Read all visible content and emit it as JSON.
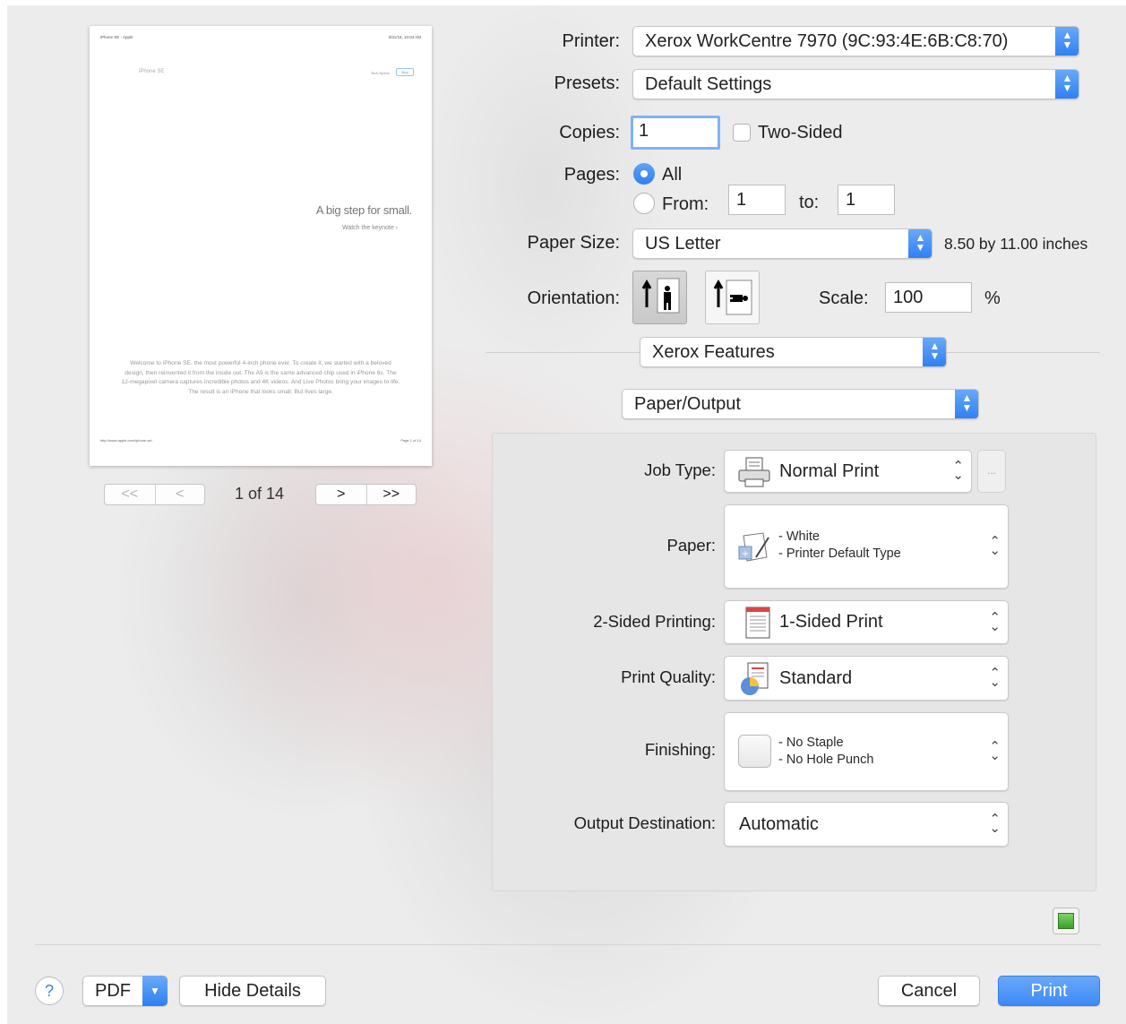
{
  "preview": {
    "header_left": "iPhone SE - Apple",
    "header_right": "3/31/16, 10:04 AM",
    "nav_left": "iPhone SE",
    "nav_right_link": "Tech Specs",
    "nav_right_btn": "Buy",
    "headline": "A big step for small.",
    "subline": "Watch the keynote ›",
    "paragraph": "Welcome to iPhone SE, the most powerful 4-inch phone ever. To create it, we started with a beloved design, then reinvented it from the inside out. The A9 is the same advanced chip used in iPhone 6s. The 12-megapixel camera captures incredible photos and 4K videos. And Live Photos bring your images to life. The result is an iPhone that looks small. But lives large.",
    "footer_left": "http://www.apple.com/iphone-se/",
    "footer_right": "Page 1 of 14",
    "page_indicator": "1 of 14",
    "first_label": "<<",
    "prev_label": "<",
    "next_label": ">",
    "last_label": ">>"
  },
  "printer": {
    "label": "Printer:",
    "value": "Xerox WorkCentre 7970 (9C:93:4E:6B:C8:70)"
  },
  "presets": {
    "label": "Presets:",
    "value": "Default Settings"
  },
  "copies": {
    "label": "Copies:",
    "value": "1",
    "two_sided_label": "Two-Sided"
  },
  "pages": {
    "label": "Pages:",
    "all_label": "All",
    "from_label": "From:",
    "from_value": "1",
    "to_label": "to:",
    "to_value": "1"
  },
  "paper_size": {
    "label": "Paper Size:",
    "value": "US Letter",
    "dimensions": "8.50 by 11.00 inches"
  },
  "orientation": {
    "label": "Orientation:"
  },
  "scale": {
    "label": "Scale:",
    "value": "100",
    "unit": "%"
  },
  "feature_popup": "Xerox Features",
  "section_popup": "Paper/Output",
  "xerox": {
    "job_type": {
      "label": "Job Type:",
      "value": "Normal Print",
      "more": "..."
    },
    "paper": {
      "label": "Paper:",
      "line1": "- White",
      "line2": "- Printer Default Type"
    },
    "two_sided": {
      "label": "2-Sided Printing:",
      "value": "1-Sided Print"
    },
    "quality": {
      "label": "Print Quality:",
      "value": "Standard"
    },
    "finishing": {
      "label": "Finishing:",
      "line1": "- No Staple",
      "line2": "- No Hole Punch"
    },
    "output": {
      "label": "Output Destination:",
      "value": "Automatic"
    }
  },
  "footer": {
    "help_label": "?",
    "pdf_label": "PDF",
    "hide_details_label": "Hide Details",
    "cancel_label": "Cancel",
    "print_label": "Print"
  },
  "colors": {
    "accent": "#2f7ff2",
    "print_button": "#3d8af5",
    "panel": "#e6e6e6"
  }
}
